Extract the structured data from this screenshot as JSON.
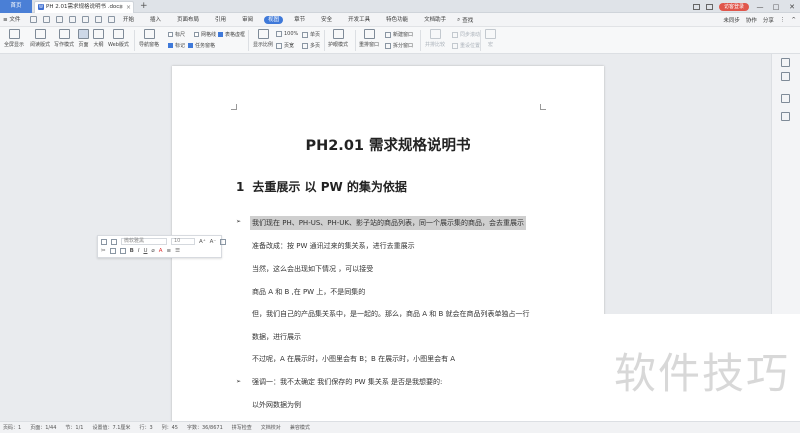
{
  "titlebar": {
    "home_tab": "首页",
    "doc_tab": "PH 2.01需求规格说明书 .docx",
    "doc_tab_icon": "W",
    "add_tab": "+",
    "login_button": "访客登录",
    "win_controls": [
      "—",
      "□",
      "✕"
    ]
  },
  "menubar": {
    "file": "≡ 文件",
    "items": [
      "开始",
      "插入",
      "页面布局",
      "引用",
      "审阅",
      "视图",
      "章节",
      "安全",
      "开发工具",
      "特色功能",
      "文档助手"
    ],
    "active_item": "视图",
    "search": "查找",
    "right": [
      "未同步",
      "协作",
      "分享"
    ]
  },
  "ribbon": {
    "big_buttons": [
      "全屏显示",
      "阅读版式",
      "写作模式",
      "页面",
      "大纲",
      "Web版式",
      "导航窗格"
    ],
    "checks": [
      {
        "label": "标尺",
        "checked": false
      },
      {
        "label": "网格线",
        "checked": false
      },
      {
        "label": "表格虚框",
        "checked": true
      },
      {
        "label": "标记",
        "checked": true
      },
      {
        "label": "任务窗格",
        "checked": true
      }
    ],
    "zoom_buttons": [
      "显示比例",
      "100%",
      "页宽",
      "单页",
      "多页"
    ],
    "eye_button": "护眼模式",
    "window_buttons": [
      "重排窗口",
      "新建窗口",
      "拆分窗口"
    ],
    "disabled_buttons": [
      "并排比较",
      "同步滚动",
      "重设位置",
      "宏"
    ]
  },
  "document": {
    "title": "PH2.01 需求规格说明书",
    "heading_num": "1",
    "heading_text": "去重展示  以  PW  的集为依据",
    "lines": [
      "我们现在 PH、PH-US、PH-UK、影子站的商品列表，同一个展示集的商品，会去重展示",
      "准备改成：按  PW 通讯过来的集关系，进行去重展示",
      "当然，这么会出现如下情况 ，可以接受",
      "商品 A 和 B ,在 PW 上，不是同集的",
      "但，我们自己的产品集关系中，是一起的。那么，商品 A 和 B 就会在商品列表单独占一行",
      "数据，进行展示",
      "不过呢，A 在展示时，小图里会有 B；B 在展示时，小图里会有 A",
      "强调一：我不太确定  我们保存的 PW 集关系  是否是我想要的:",
      "以外网数据为例"
    ]
  },
  "floating_toolbar": {
    "font": "微软雅黑",
    "size": "10"
  },
  "watermark": "软件技巧",
  "statusbar": {
    "items": [
      "页码：1",
      "页面：1/44",
      "节：1/1",
      "设置值：7.1厘米",
      "行：3",
      "列：45",
      "字数：36/8671",
      "拼写检查",
      "文档校对",
      "兼容模式"
    ]
  }
}
